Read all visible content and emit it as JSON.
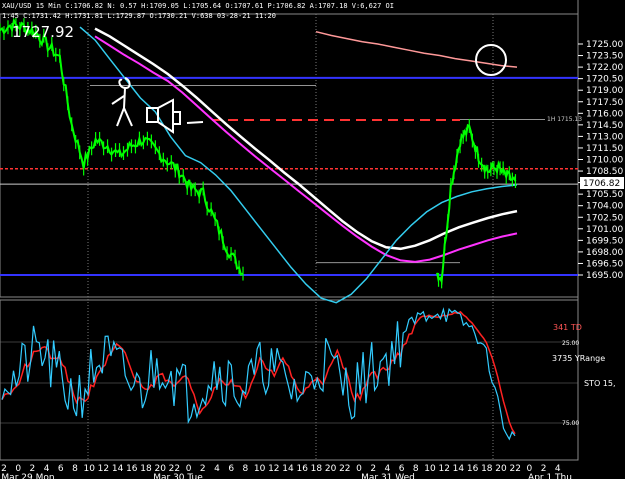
{
  "header": {
    "line1": "XAU/USD 15 Min  C:1706.82  N:  0.57  H:1709.05  L:1705.64  O:1707.61  P:1706.82  A:1707.18  V:6,627  OI",
    "line2": "1:45  C:1731.42  H:1731.81  L:1729.87  O:1730.21  V:638  03-28-21  11:20",
    "big_price": "1727.92"
  },
  "price_panel": {
    "ticks": [
      "1725.00",
      "1723.50",
      "1722.00",
      "1720.50",
      "1719.00",
      "1717.50",
      "1716.00",
      "1714.50",
      "1713.00",
      "1711.50",
      "1710.00",
      "1708.50",
      "1707.00",
      "1705.50",
      "1704.00",
      "1702.50",
      "1701.00",
      "1699.50",
      "1698.00",
      "1696.50",
      "1695.00"
    ],
    "current_price": "1706.82",
    "level_label": "1H 1715.13",
    "blue_lines": [
      1720.6,
      1695.0
    ],
    "red_line": 1708.8,
    "white_line": 1706.8,
    "colors": {
      "price": "#00ff00",
      "sma_fast": "#ffffff",
      "sma_slow": "#ff33ff",
      "ema": "#33ccee",
      "long_ma": "#ff9999",
      "level_line": "#ff3333",
      "blue_line": "#3333ff"
    }
  },
  "indicator_panel": {
    "labels": [
      "341 TD",
      "3735 YRange",
      "STO  15,"
    ],
    "ticks": [
      "25.00",
      "75.00"
    ],
    "colors": {
      "fast": "#33ccff",
      "slow": "#ff2222"
    }
  },
  "x_axis": {
    "hours": [
      "2",
      "0",
      "2",
      "4",
      "6",
      "8",
      "10",
      "12",
      "14",
      "16",
      "18",
      "20",
      "22",
      "0",
      "2",
      "4",
      "6",
      "8",
      "10",
      "12",
      "14",
      "16",
      "18",
      "20",
      "22",
      "0",
      "2",
      "4",
      "6",
      "8",
      "10",
      "12",
      "14",
      "16",
      "18",
      "20",
      "22",
      "0",
      "2",
      "4"
    ],
    "day_labels": [
      "Mar 29 Mon",
      "Mar 30 Tue",
      "Mar 31 Wed",
      "Apr 1 Thu"
    ]
  },
  "chart_data": {
    "type": "line",
    "series": [
      {
        "values": [
          1726.8,
          1727.5,
          1727.2,
          1726.5,
          1724.8,
          1723.2,
          1714.5,
          1709.5,
          1712.5,
          1711.8,
          1710.5,
          1711.8,
          1712.6,
          1711.2,
          1709.8,
          1708.5,
          1706.2,
          1705.6,
          1702.0,
          1698.5,
          1696.0,
          1694.6,
          1706.5,
          1712.5,
          1714.0,
          1710.5,
          1708.5,
          1709.0,
          1707.8,
          1707.2
        ]
      },
      {
        "values": [
          1727.0,
          1726.0,
          1724.8,
          1723.6,
          1722.4,
          1721.1,
          1719.6,
          1718.0,
          1716.3,
          1714.6,
          1713.0,
          1711.4,
          1709.9,
          1708.3,
          1706.8,
          1705.2,
          1703.6,
          1702.0,
          1700.6,
          1699.4,
          1698.6,
          1698.4,
          1698.8,
          1699.5,
          1700.4,
          1701.2,
          1701.8,
          1702.4,
          1702.9,
          1703.3
        ]
      },
      {
        "values": [
          1726.0,
          1724.8,
          1723.6,
          1722.5,
          1721.3,
          1720.2,
          1718.7,
          1717.0,
          1715.3,
          1713.6,
          1712.0,
          1710.4,
          1708.9,
          1707.4,
          1705.9,
          1704.4,
          1702.9,
          1701.4,
          1700.0,
          1698.7,
          1697.6,
          1696.9,
          1696.7,
          1697.0,
          1697.6,
          1698.3,
          1698.9,
          1699.5,
          1700.0,
          1700.4
        ]
      },
      {
        "values": [
          1727.2,
          1725.5,
          1723.0,
          1720.5,
          1718.0,
          1716.2,
          1713.0,
          1710.5,
          1709.6,
          1708.0,
          1706.0,
          1703.5,
          1701.0,
          1698.5,
          1696.0,
          1693.8,
          1692.0,
          1691.4,
          1692.5,
          1694.5,
          1697.0,
          1699.5,
          1701.5,
          1703.2,
          1704.4,
          1705.2,
          1705.8,
          1706.2,
          1706.5,
          1706.7
        ]
      },
      {
        "values": [
          1726.6,
          1726.1,
          1725.7,
          1725.3,
          1725.0,
          1724.6,
          1724.2,
          1723.8,
          1723.5,
          1723.1,
          1722.8,
          1722.5,
          1722.2,
          1722.0
        ]
      }
    ]
  }
}
